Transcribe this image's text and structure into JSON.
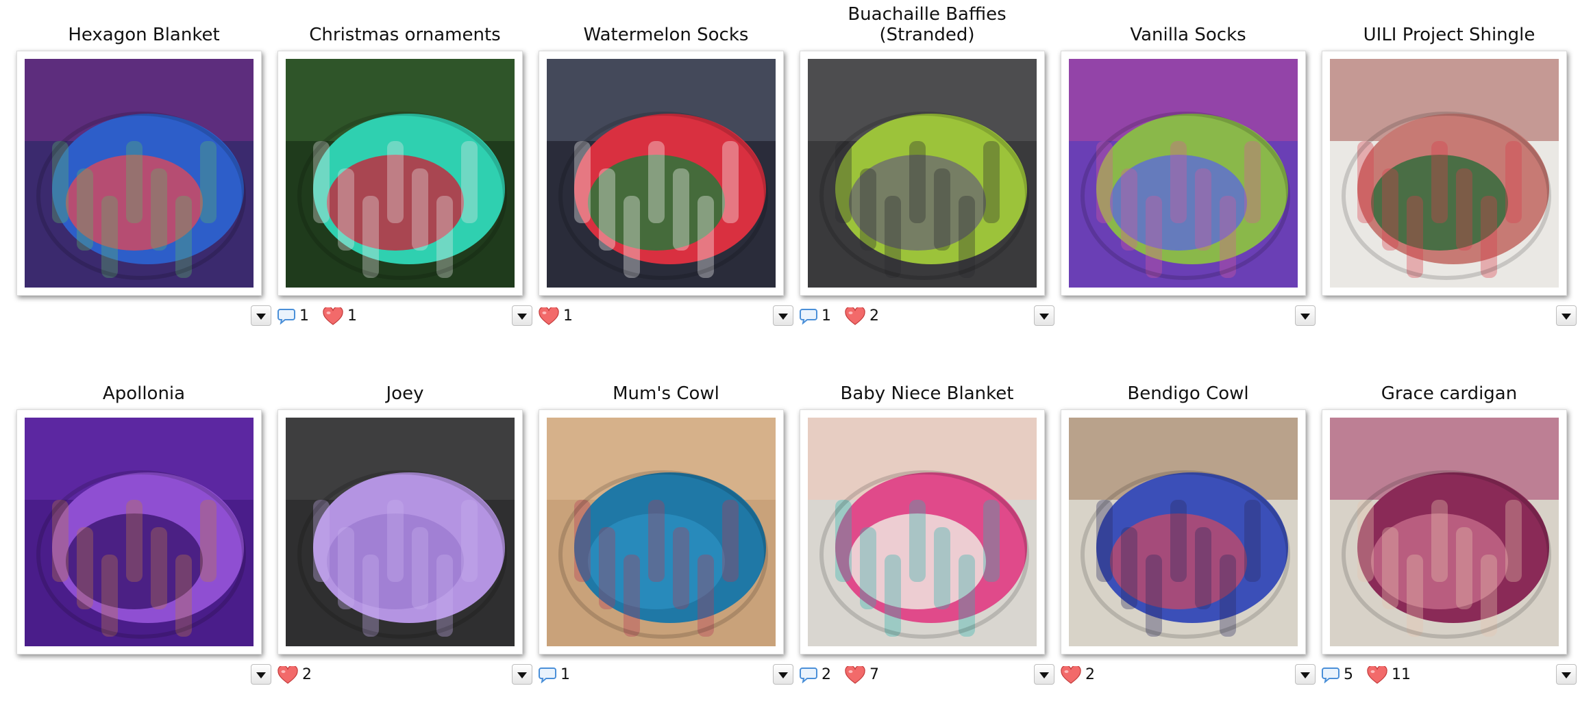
{
  "projects": [
    {
      "title": "Hexagon Blanket",
      "photo_icon": "crochet-hexagon-blanket-photo",
      "comments": null,
      "loves": null,
      "palette": [
        "#3b2a6e",
        "#7a2f8a",
        "#2d5ec9",
        "#d8485c",
        "#5bb56b"
      ]
    },
    {
      "title": "Christmas ornaments",
      "photo_icon": "mini-sweater-ornament-photo",
      "comments": "1",
      "loves": "1",
      "palette": [
        "#1f3b1c",
        "#3d6b35",
        "#2fd0b0",
        "#c8233a",
        "#e7e7e7"
      ]
    },
    {
      "title": "Watermelon Socks",
      "photo_icon": "watermelon-sock-photo",
      "comments": null,
      "loves": "1",
      "palette": [
        "#2a2c3a",
        "#5a6275",
        "#d93040",
        "#1f7a3a",
        "#ffffff"
      ]
    },
    {
      "title": "Buachaille Baffies\n(Stranded)",
      "photo_icon": "stranded-slippers-photo",
      "comments": "1",
      "loves": "2",
      "palette": [
        "#3a3a3c",
        "#5c5c5e",
        "#9cc33a",
        "#6d6d6f",
        "#2c2c2e"
      ]
    },
    {
      "title": "Vanilla Socks",
      "photo_icon": "striped-sock-photo",
      "comments": null,
      "loves": null,
      "palette": [
        "#6a3fb5",
        "#b4489c",
        "#8ab84a",
        "#5b6bd8",
        "#d75a9a"
      ]
    },
    {
      "title": "UILI Project Shingle",
      "photo_icon": "tweed-top-photo",
      "comments": null,
      "loves": null,
      "palette": [
        "#eae8e4",
        "#a55752",
        "#c77a74",
        "#2a6b3a",
        "#d93b4a"
      ]
    },
    {
      "title": "Apollonia",
      "photo_icon": "purple-cabled-sweater-photo",
      "comments": null,
      "loves": null,
      "palette": [
        "#4a1d8a",
        "#6c2fb4",
        "#8f4fd2",
        "#3a1470",
        "#c07a48"
      ]
    },
    {
      "title": "Joey",
      "photo_icon": "lilac-baby-cardigan-photo",
      "comments": null,
      "loves": "2",
      "palette": [
        "#2f2f30",
        "#4a4a4c",
        "#b494e2",
        "#9c7ad1",
        "#c9b2ee"
      ]
    },
    {
      "title": "Mum's Cowl",
      "photo_icon": "teal-cowl-photo",
      "comments": "1",
      "loves": null,
      "palette": [
        "#c9a27a",
        "#e0bd98",
        "#1f78a6",
        "#2a8fc0",
        "#b53a56"
      ]
    },
    {
      "title": "Baby Niece Blanket",
      "photo_icon": "baby-blanket-photo",
      "comments": "2",
      "loves": "7",
      "palette": [
        "#d9d6d0",
        "#f2c7b6",
        "#e04a8a",
        "#f0ede4",
        "#2bb4b0"
      ]
    },
    {
      "title": "Bendigo Cowl",
      "photo_icon": "gradient-cowl-photo",
      "comments": null,
      "loves": "2",
      "palette": [
        "#d8d3c8",
        "#a07a5a",
        "#3b4fb8",
        "#c04a6a",
        "#2c2c5e"
      ]
    },
    {
      "title": "Grace cardigan",
      "photo_icon": "raspberry-cardigan-photo",
      "comments": "5",
      "loves": "11",
      "palette": [
        "#d8d2c8",
        "#a83a6a",
        "#8a2a57",
        "#c46a8a",
        "#e8c6b0"
      ]
    }
  ],
  "icons": {
    "comment": "speech-bubble-icon",
    "love": "heart-icon",
    "menu": "dropdown-arrow-icon"
  },
  "colors": {
    "comment_icon": "#4a8fd8",
    "heart_fill": "#f26a6a",
    "heart_stroke": "#c23a3a"
  }
}
